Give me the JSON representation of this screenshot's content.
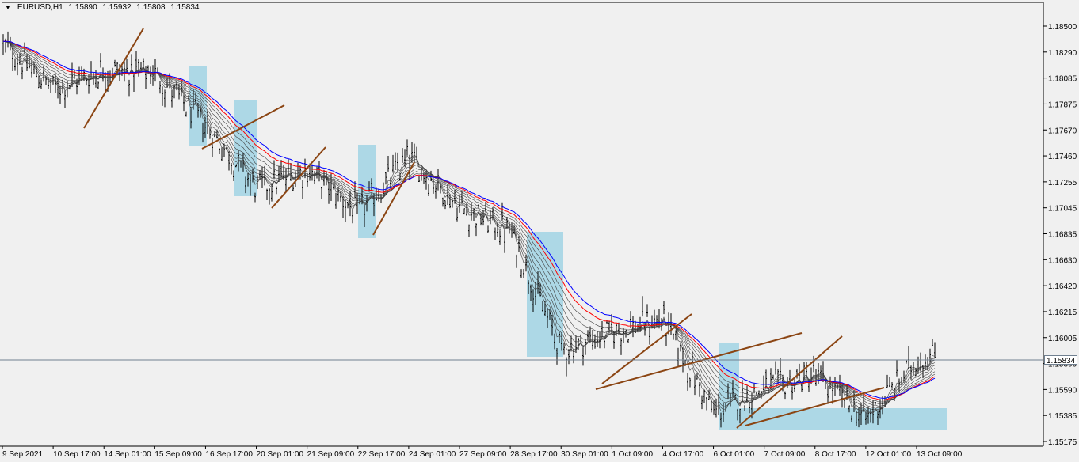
{
  "header": {
    "symbol": "EURUSD,H1",
    "open": "1.15890",
    "high": "1.15932",
    "low": "1.15808",
    "close": "1.15834"
  },
  "price_axis": {
    "labels": [
      "1.18500",
      "1.18290",
      "1.18085",
      "1.17875",
      "1.17670",
      "1.17460",
      "1.17255",
      "1.17045",
      "1.16835",
      "1.16630",
      "1.16420",
      "1.16215",
      "1.16005",
      "1.15800",
      "1.15590",
      "1.15385",
      "1.15175"
    ],
    "current_price": "1.15834"
  },
  "time_axis": {
    "labels": [
      "9 Sep 2021",
      "10 Sep 17:00",
      "14 Sep 01:00",
      "15 Sep 09:00",
      "16 Sep 17:00",
      "20 Sep 01:00",
      "21 Sep 09:00",
      "22 Sep 17:00",
      "24 Sep 01:00",
      "27 Sep 09:00",
      "28 Sep 17:00",
      "30 Sep 01:00",
      "1 Oct 09:00",
      "4 Oct 17:00",
      "6 Oct 01:00",
      "7 Oct 09:00",
      "8 Oct 17:00",
      "12 Oct 01:00",
      "13 Oct 09:00"
    ]
  },
  "colors": {
    "background": "#f0f0f0",
    "price_line": "#708090",
    "trend_line": "#8b4513",
    "zone": "#add8e6",
    "ma_fast": "#ff0000",
    "ma_slow": "#0000ff",
    "ma_ribbon": "#404040"
  },
  "chart_data": {
    "type": "candlestick",
    "symbol": "EURUSD",
    "timeframe": "H1",
    "ylim": [
      1.1514,
      1.1862
    ],
    "last_price": 1.15834,
    "indicators": [
      "moving-average-ribbon"
    ],
    "close_path": [
      {
        "x": "9 Sep 2021",
        "y": 1.1835
      },
      {
        "x": "10 Sep 17:00",
        "y": 1.18
      },
      {
        "x": "14 Sep 01:00",
        "y": 1.1815
      },
      {
        "x": "15 Sep 09:00",
        "y": 1.1812
      },
      {
        "x": "16 Sep 17:00",
        "y": 1.177
      },
      {
        "x": "20 Sep 01:00",
        "y": 1.172
      },
      {
        "x": "21 Sep 09:00",
        "y": 1.1735
      },
      {
        "x": "22 Sep 17:00",
        "y": 1.17
      },
      {
        "x": "24 Sep 01:00",
        "y": 1.1745
      },
      {
        "x": "27 Sep 09:00",
        "y": 1.1705
      },
      {
        "x": "28 Sep 17:00",
        "y": 1.1685
      },
      {
        "x": "30 Sep 01:00",
        "y": 1.159
      },
      {
        "x": "1 Oct 09:00",
        "y": 1.1605
      },
      {
        "x": "4 Oct 17:00",
        "y": 1.1615
      },
      {
        "x": "6 Oct 01:00",
        "y": 1.154
      },
      {
        "x": "7 Oct 09:00",
        "y": 1.156
      },
      {
        "x": "8 Oct 17:00",
        "y": 1.157
      },
      {
        "x": "12 Oct 01:00",
        "y": 1.1535
      },
      {
        "x": "13 Oct 09:00",
        "y": 1.1583
      }
    ]
  }
}
